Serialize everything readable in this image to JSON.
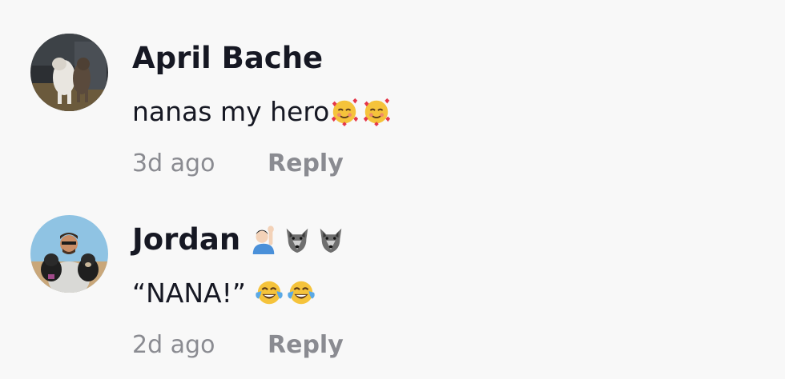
{
  "comments": [
    {
      "username": "April Bache",
      "username_emojis": [],
      "text": "nanas my hero",
      "text_emojis": [
        "smiling-face-with-hearts",
        "smiling-face-with-hearts"
      ],
      "timestamp": "3d ago",
      "reply_label": "Reply",
      "avatar_icon": "dogs-in-car-avatar"
    },
    {
      "username": "Jordan",
      "username_emojis": [
        "person-raising-hand",
        "wolf",
        "wolf"
      ],
      "text": "“NANA!”",
      "text_emojis": [
        "face-with-tears-of-joy",
        "face-with-tears-of-joy"
      ],
      "timestamp": "2d ago",
      "reply_label": "Reply",
      "avatar_icon": "man-with-dogs-avatar"
    }
  ]
}
